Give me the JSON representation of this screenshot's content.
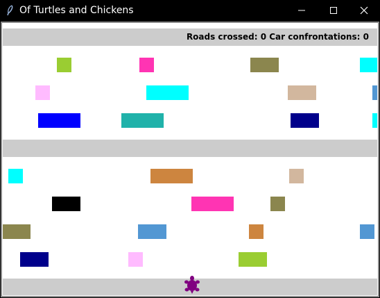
{
  "window": {
    "title": "Of Turtles and Chickens"
  },
  "scoreboard": {
    "text": "Roads crossed: 0 Car confrontations: 0"
  },
  "colors": {
    "background": "#ffffff",
    "sidewalk": "#cccccc",
    "turtle": "#800080"
  },
  "game": {
    "player": "turtle",
    "cars": [
      {
        "color": "#9acd32"
      },
      {
        "color": "#ff34b3"
      },
      {
        "color": "#8b864e"
      },
      {
        "color": "#00ffff"
      },
      {
        "color": "#ffbbff"
      },
      {
        "color": "#00ffff"
      },
      {
        "color": "#d2b79e"
      },
      {
        "color": "#5297d3"
      },
      {
        "color": "#0000ff"
      },
      {
        "color": "#20b2aa"
      },
      {
        "color": "#00008b"
      },
      {
        "color": "#00ffff"
      },
      {
        "color": "#00ffff"
      },
      {
        "color": "#cd853f"
      },
      {
        "color": "#d2b79e"
      },
      {
        "color": "#000000"
      },
      {
        "color": "#ff34b3"
      },
      {
        "color": "#8b864e"
      },
      {
        "color": "#8b864e"
      },
      {
        "color": "#5297d3"
      },
      {
        "color": "#cd853f"
      },
      {
        "color": "#5297d3"
      },
      {
        "color": "#00008b"
      },
      {
        "color": "#ffbbff"
      },
      {
        "color": "#9acd32"
      }
    ]
  }
}
